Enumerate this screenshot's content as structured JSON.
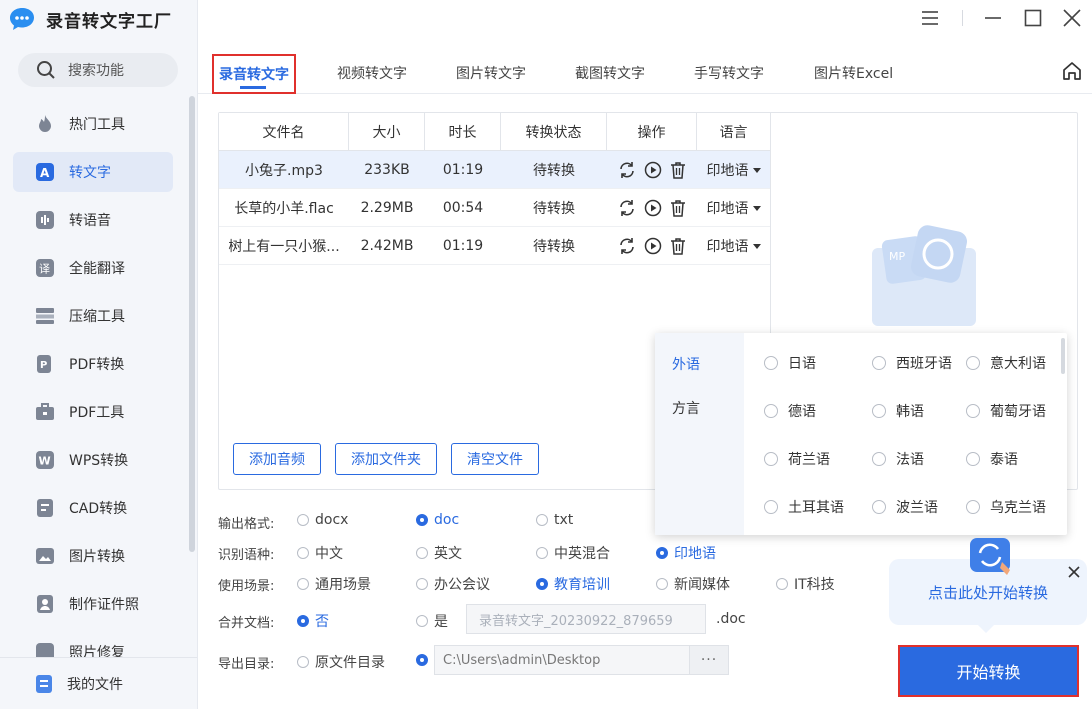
{
  "app": {
    "title": "录音转文字工厂"
  },
  "sidebar": {
    "search_label": "搜索功能",
    "items": [
      {
        "label": "热门工具",
        "icon": "flame-icon"
      },
      {
        "label": "转文字",
        "icon": "text-convert-icon",
        "active": true
      },
      {
        "label": "转语音",
        "icon": "voice-icon"
      },
      {
        "label": "全能翻译",
        "icon": "translate-icon"
      },
      {
        "label": "压缩工具",
        "icon": "compress-icon"
      },
      {
        "label": "PDF转换",
        "icon": "pdf-convert-icon"
      },
      {
        "label": "PDF工具",
        "icon": "toolbox-icon"
      },
      {
        "label": "WPS转换",
        "icon": "wps-icon"
      },
      {
        "label": "CAD转换",
        "icon": "cad-icon"
      },
      {
        "label": "图片转换",
        "icon": "image-icon"
      },
      {
        "label": "制作证件照",
        "icon": "id-photo-icon"
      },
      {
        "label": "照片修复",
        "icon": "photo-repair-icon"
      }
    ],
    "my_files": "我的文件"
  },
  "tabs": [
    "录音转文字",
    "视频转文字",
    "图片转文字",
    "截图转文字",
    "手写转文字",
    "图片转Excel"
  ],
  "table": {
    "headers": [
      "文件名",
      "大小",
      "时长",
      "转换状态",
      "操作",
      "语言"
    ],
    "rows": [
      {
        "name": "小兔子.mp3",
        "size": "233KB",
        "duration": "01:19",
        "status": "待转换",
        "lang": "印地语"
      },
      {
        "name": "长草的小羊.flac",
        "size": "2.29MB",
        "duration": "00:54",
        "status": "待转换",
        "lang": "印地语"
      },
      {
        "name": "树上有一只小猴...",
        "size": "2.42MB",
        "duration": "01:19",
        "status": "待转换",
        "lang": "印地语"
      }
    ]
  },
  "buttons": {
    "add_audio": "添加音频",
    "add_folder": "添加文件夹",
    "clear": "清空文件",
    "start": "开始转换"
  },
  "settings": {
    "format": {
      "label": "输出格式:",
      "options": [
        "docx",
        "doc",
        "txt"
      ],
      "selected": "doc"
    },
    "language": {
      "label": "识别语种:",
      "options": [
        "中文",
        "英文",
        "中英混合",
        "印地语"
      ],
      "selected": "印地语"
    },
    "scene": {
      "label": "使用场景:",
      "options": [
        "通用场景",
        "办公会议",
        "教育培训",
        "新闻媒体",
        "IT科技"
      ],
      "selected": "教育培训"
    },
    "merge": {
      "label": "合并文档:",
      "options": [
        "否",
        "是"
      ],
      "selected": "否",
      "filename": "录音转文字_20230922_879659",
      "ext": ".doc"
    },
    "export": {
      "label": "导出目录:",
      "options": [
        "原文件目录"
      ],
      "path": "C:\\Users\\admin\\Desktop",
      "browse": "···"
    }
  },
  "lang_popup": {
    "categories": [
      "外语",
      "方言"
    ],
    "active_category": "外语",
    "options": [
      [
        "日语",
        "西班牙语",
        "意大利语"
      ],
      [
        "德语",
        "韩语",
        "葡萄牙语"
      ],
      [
        "荷兰语",
        "法语",
        "泰语"
      ],
      [
        "土耳其语",
        "波兰语",
        "乌克兰语"
      ]
    ]
  },
  "tooltip": {
    "text": "点击此处开始转换"
  },
  "colors": {
    "accent": "#2a6ae0",
    "highlight_border": "#e0302c"
  }
}
